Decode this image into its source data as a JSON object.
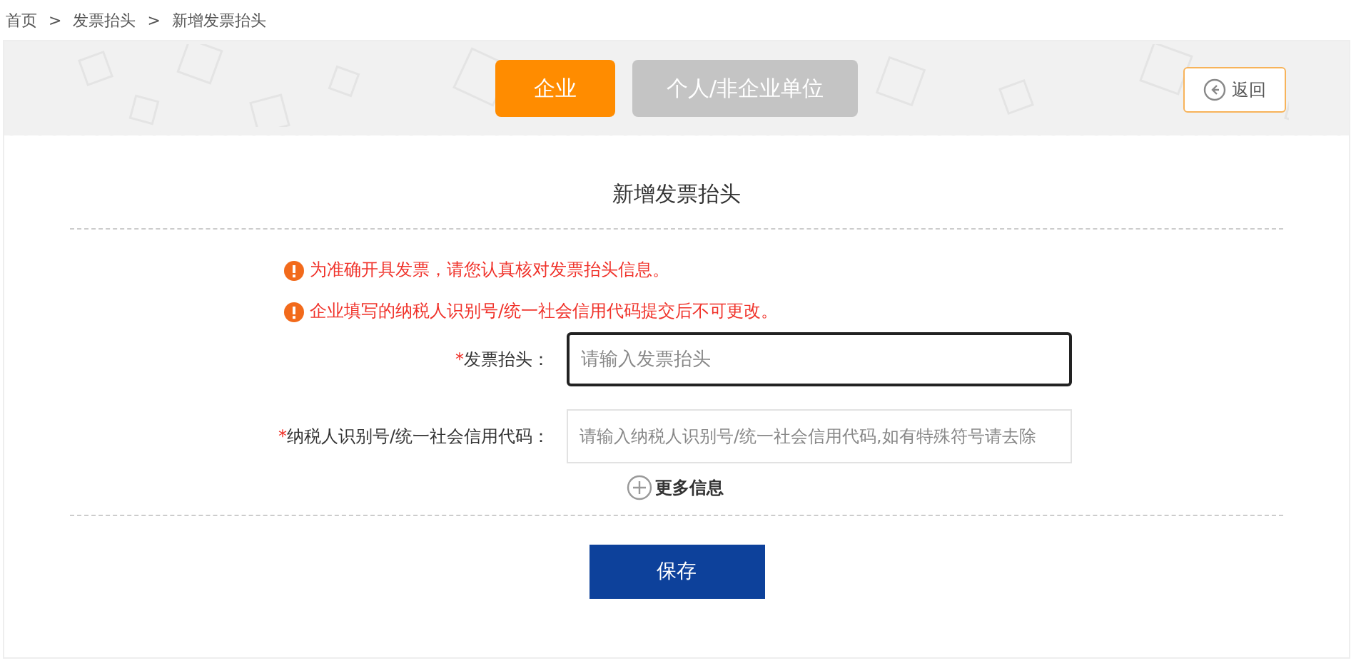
{
  "breadcrumb": [
    {
      "label": "首页"
    },
    {
      "label": "发票抬头"
    },
    {
      "label": "新增发票抬头"
    }
  ],
  "breadcrumb_separator": ">",
  "tabs": [
    {
      "label": "企业",
      "selected": true
    },
    {
      "label": "个人/非企业单位",
      "selected": false
    }
  ],
  "back_button": {
    "label": "返回"
  },
  "form": {
    "title": "新增发票抬头",
    "warnings": [
      "为准确开具发票，请您认真核对发票抬头信息。",
      "企业填写的纳税人识别号/统一社会信用代码提交后不可更改。"
    ],
    "fields": [
      {
        "required_mark": "*",
        "label": "发票抬头：",
        "placeholder": "请输入发票抬头",
        "focused": true
      },
      {
        "required_mark": "*",
        "label": "纳税人识别号/统一社会信用代码：",
        "placeholder": "请输入纳税人识别号/统一社会信用代码,如有特殊符号请去除",
        "focused": false
      }
    ],
    "more_link": "更多信息",
    "save_button": "保存"
  }
}
